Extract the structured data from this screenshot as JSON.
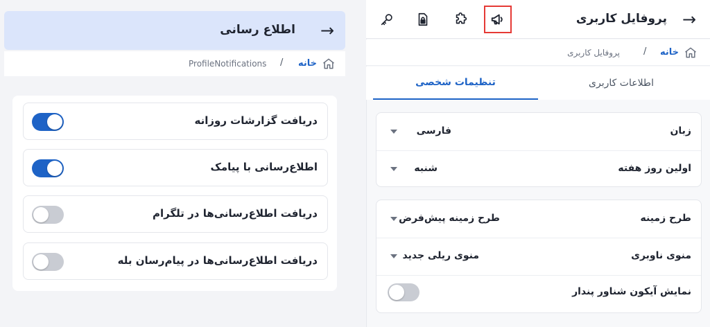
{
  "right": {
    "header": {
      "title": "پروفایل کاربری",
      "back_glyph": "→",
      "icons": [
        "megaphone-icon",
        "puzzle-icon",
        "lock-file-icon",
        "key-icon"
      ],
      "active_icon": "megaphone-icon",
      "active_color": "#e53935"
    },
    "breadcrumb": {
      "home": "خانه",
      "separator": "/",
      "current": "پروفایل کاربری"
    },
    "tabs": [
      {
        "label": "تنظیمات شخصی",
        "active": true
      },
      {
        "label": "اطلاعات کاربری",
        "active": false
      }
    ],
    "card1": [
      {
        "label": "زبان",
        "value": "فارسی"
      },
      {
        "label": "اولین روز هفته",
        "value": "شنبه"
      }
    ],
    "card2": [
      {
        "label": "طرح زمینه",
        "value": "طرح زمینه پیش‌فرض"
      },
      {
        "label": "منوی ناوبری",
        "value": "منوی ریلی جدید"
      },
      {
        "label": "نمایش آیکون شناور پندار",
        "toggle": false
      }
    ]
  },
  "left": {
    "header": {
      "title": "اطلاع رسانی",
      "back_glyph": "→",
      "bg_color": "#dbe5fb"
    },
    "breadcrumb": {
      "home": "خانه",
      "separator": "/",
      "current": "ProfileNotifications"
    },
    "rows": [
      {
        "label": "دریافت گزارشات روزانه",
        "toggle": true
      },
      {
        "label": "اطلاع‌رسانی با پیامک",
        "toggle": true
      },
      {
        "label": "دریافت اطلاع‌رسانی‌ها در تلگرام",
        "toggle": false
      },
      {
        "label": "دریافت اطلاع‌رسانی‌ها در پیام‌رسان بله",
        "toggle": false
      }
    ]
  },
  "colors": {
    "accent": "#1e63c6",
    "toggle_off": "#c9ccd3",
    "highlight": "#e53935"
  }
}
